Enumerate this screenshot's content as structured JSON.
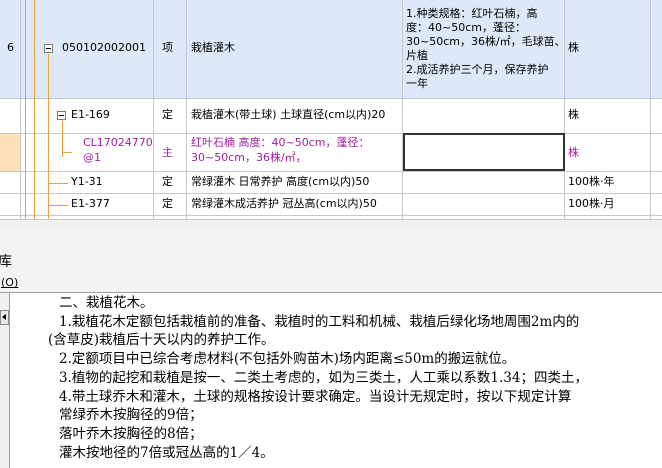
{
  "grid": {
    "rows": [
      {
        "num": "6",
        "code": "050102002001",
        "type": "项",
        "name": "栽植灌木",
        "feature": [
          "1.种类规格：红叶石楠，高",
          "度：40~50cm，蓬径：",
          "30~50cm，36株/㎡，毛球苗、",
          "片植",
          "2.成活养护三个月，保存养护",
          "一年"
        ],
        "unit": "株"
      },
      {
        "code": "E1-169",
        "type": "定",
        "name": "栽植灌木(带土球) 土球直径(cm以内)20",
        "unit": "株"
      },
      {
        "code_lines": [
          "CL17024770",
          "@1"
        ],
        "type": "主",
        "name_lines": [
          "红叶石楠 高度：40~50cm，蓬径：",
          "30~50cm，36株/㎡，"
        ],
        "unit": "株"
      },
      {
        "code": "Y1-31",
        "type": "定",
        "name": "常绿灌木 日常养护 高度(cm以内)50",
        "unit": "100株·年"
      },
      {
        "code": "E1-377",
        "type": "定",
        "name": "常绿灌木成活养护 冠丛高(cm以内)50",
        "unit": "100株·月"
      }
    ]
  },
  "tab": {
    "title": "库",
    "shortcut": "(O)"
  },
  "doc": {
    "lines": [
      "二、栽植花木。",
      "1.栽植花木定额包括栽植前的准备、栽植时的工料和机械、栽植后绿化场地周围2m内的",
      "(含草皮)栽植后十天以内的养护工作。",
      "2.定额项目中已综合考虑材料(不包括外购苗木)场内距离≤50m的搬运就位。",
      "3.植物的起挖和栽植是按一、二类土考虑的，如为三类土，人工乘以系数1.34；四类土，",
      "4.带土球乔木和灌木，土球的规格按设计要求确定。当设计无规定时，按以下规定计算",
      "常绿乔木按胸径的9倍；",
      "落叶乔木按胸径的8倍；",
      "灌木按地径的7倍或冠丛高的1／4。"
    ]
  },
  "colors": {
    "selected_row": "#dde8f8",
    "active_row": "#fde0b8",
    "tree_line": "#e6a637",
    "purple_text": "#a020a0"
  }
}
